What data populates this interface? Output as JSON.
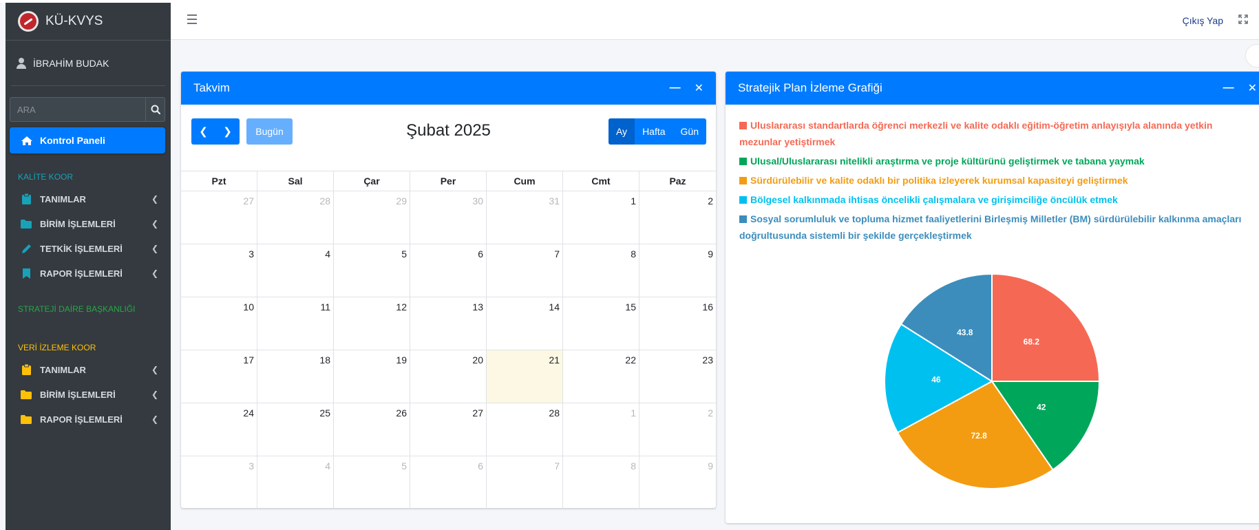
{
  "brand": {
    "title": "KÜ-KVYS"
  },
  "user": {
    "name": "İBRAHİM BUDAK"
  },
  "search": {
    "placeholder": "ARA"
  },
  "nav": {
    "active": "Kontrol Paneli",
    "sections": [
      {
        "header": "KALİTE KOOR",
        "color": "#17a2b8",
        "items": [
          {
            "label": "TANIMLAR",
            "icon": "clipboard-icon",
            "icon_color": "#17a2b8"
          },
          {
            "label": "BİRİM İŞLEMLERİ",
            "icon": "folder-icon",
            "icon_color": "#17a2b8"
          },
          {
            "label": "TETKİK İŞLEMLERİ",
            "icon": "pencil-icon",
            "icon_color": "#17a2b8"
          },
          {
            "label": "RAPOR İŞLEMLERİ",
            "icon": "bookmark-icon",
            "icon_color": "#17a2b8"
          }
        ]
      },
      {
        "header": "STRATEJİ DAİRE BAŞKANLIĞI",
        "color": "#28a745",
        "items": []
      },
      {
        "header": "VERİ İZLEME KOOR",
        "color": "#ffc107",
        "items": [
          {
            "label": "TANIMLAR",
            "icon": "clipboard-icon",
            "icon_color": "#ffc107"
          },
          {
            "label": "BİRİM İŞLEMLERİ",
            "icon": "folder-icon",
            "icon_color": "#ffc107"
          },
          {
            "label": "RAPOR İŞLEMLERİ",
            "icon": "folder-icon",
            "icon_color": "#ffc107"
          }
        ]
      }
    ]
  },
  "header": {
    "logout": "Çıkış Yap"
  },
  "calendar": {
    "card_title": "Takvim",
    "today_label": "Bugün",
    "month_title": "Şubat 2025",
    "views": [
      "Ay",
      "Hafta",
      "Gün"
    ],
    "active_view": "Ay",
    "weekdays": [
      "Pzt",
      "Sal",
      "Çar",
      "Per",
      "Cum",
      "Cmt",
      "Paz"
    ],
    "weeks": [
      [
        27,
        28,
        29,
        30,
        31,
        1,
        2
      ],
      [
        3,
        4,
        5,
        6,
        7,
        8,
        9
      ],
      [
        10,
        11,
        12,
        13,
        14,
        15,
        16
      ],
      [
        17,
        18,
        19,
        20,
        21,
        22,
        23
      ],
      [
        24,
        25,
        26,
        27,
        28,
        1,
        2
      ],
      [
        3,
        4,
        5,
        6,
        7,
        8,
        9
      ]
    ],
    "today": 21
  },
  "chart_card": {
    "title": "Stratejik Plan İzleme Grafiği"
  },
  "chart_data": {
    "type": "pie",
    "title": "Stratejik Plan İzleme Grafiği",
    "series": [
      {
        "name": "Uluslararası standartlarda öğrenci merkezli ve kalite odaklı eğitim-öğretim anlayışıyla alanında yetkin mezunlar yetiştirmek",
        "value": 68.2,
        "color": "#f56954"
      },
      {
        "name": "Ulusal/Uluslararası nitelikli araştırma ve proje kültürünü geliştirmek ve tabana yaymak",
        "value": 42,
        "color": "#00a65a"
      },
      {
        "name": "Sürdürülebilir ve kalite odaklı bir politika izleyerek kurumsal kapasiteyi geliştirmek",
        "value": 72.8,
        "color": "#f39c12"
      },
      {
        "name": "Bölgesel kalkınmada ihtisas öncelikli çalışmalara ve girişimciliğe öncülük etmek",
        "value": 46,
        "color": "#00c0ef"
      },
      {
        "name": "Sosyal sorumluluk ve topluma hizmet faaliyetlerini Birleşmiş Milletler (BM) sürdürülebilir kalkınma amaçları doğrultusunda sistemli bir şekilde gerçekleştirmek",
        "value": 43.8,
        "color": "#3c8dbc"
      }
    ],
    "legend": "top"
  }
}
